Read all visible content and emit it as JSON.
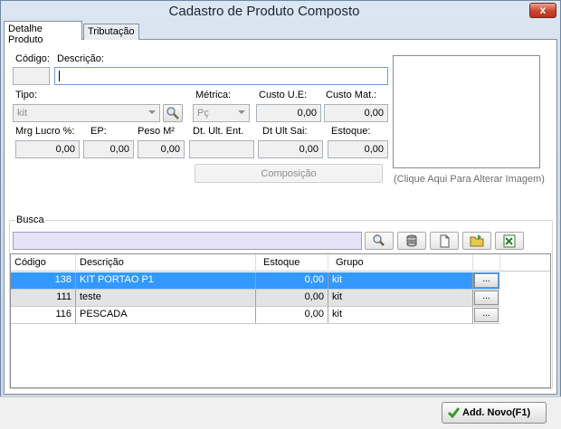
{
  "window": {
    "title": "Cadastro de Produto Composto",
    "close_label": "x"
  },
  "tabs": [
    {
      "label": "Detalhe Produto",
      "active": true
    },
    {
      "label": "Tributação",
      "active": false
    }
  ],
  "form": {
    "codigo_label": "Código:",
    "codigo_value": "",
    "descricao_label": "Descrição:",
    "descricao_value": "",
    "tipo_label": "Tipo:",
    "tipo_value": "kit",
    "metrica_label": "Métrica:",
    "metrica_value": "Pç",
    "custo_ue_label": "Custo U.E:",
    "custo_ue_value": "0,00",
    "custo_mat_label": "Custo Mat.:",
    "custo_mat_value": "0,00",
    "mrg_lucro_label": "Mrg Lucro %:",
    "mrg_lucro_value": "0,00",
    "ep_label": "EP:",
    "ep_value": "0,00",
    "peso_label": "Peso M²",
    "peso_value": "0,00",
    "dt_ult_ent_label": "Dt. Ult. Ent.",
    "dt_ult_ent_value": "",
    "dt_ult_sai_label": "Dt Ult Sai:",
    "dt_ult_sai_value": "0,00",
    "estoque_label": "Estoque:",
    "estoque_value": "0,00",
    "composicao_label": "Composição",
    "image_hint": "(Clique Aqui Para Alterar Imagem)"
  },
  "busca": {
    "label": "Busca",
    "query": "",
    "columns": [
      "Código",
      "Descrição",
      "Estoque",
      "Grupo"
    ],
    "rows": [
      {
        "codigo": "138",
        "descricao": "KIT PORTAO P1",
        "estoque": "0,00",
        "grupo": "kit",
        "action": "..."
      },
      {
        "codigo": "111",
        "descricao": "teste",
        "estoque": "0,00",
        "grupo": "kit",
        "action": "..."
      },
      {
        "codigo": "116",
        "descricao": "PESCADA",
        "estoque": "0,00",
        "grupo": "kit",
        "action": "..."
      }
    ]
  },
  "footer": {
    "add_label": "Add. Novo(F1)"
  },
  "colors": {
    "selected_row": "#3399ff",
    "alt_row": "#e3e3e3",
    "accent_green": "#3a9a2a"
  }
}
